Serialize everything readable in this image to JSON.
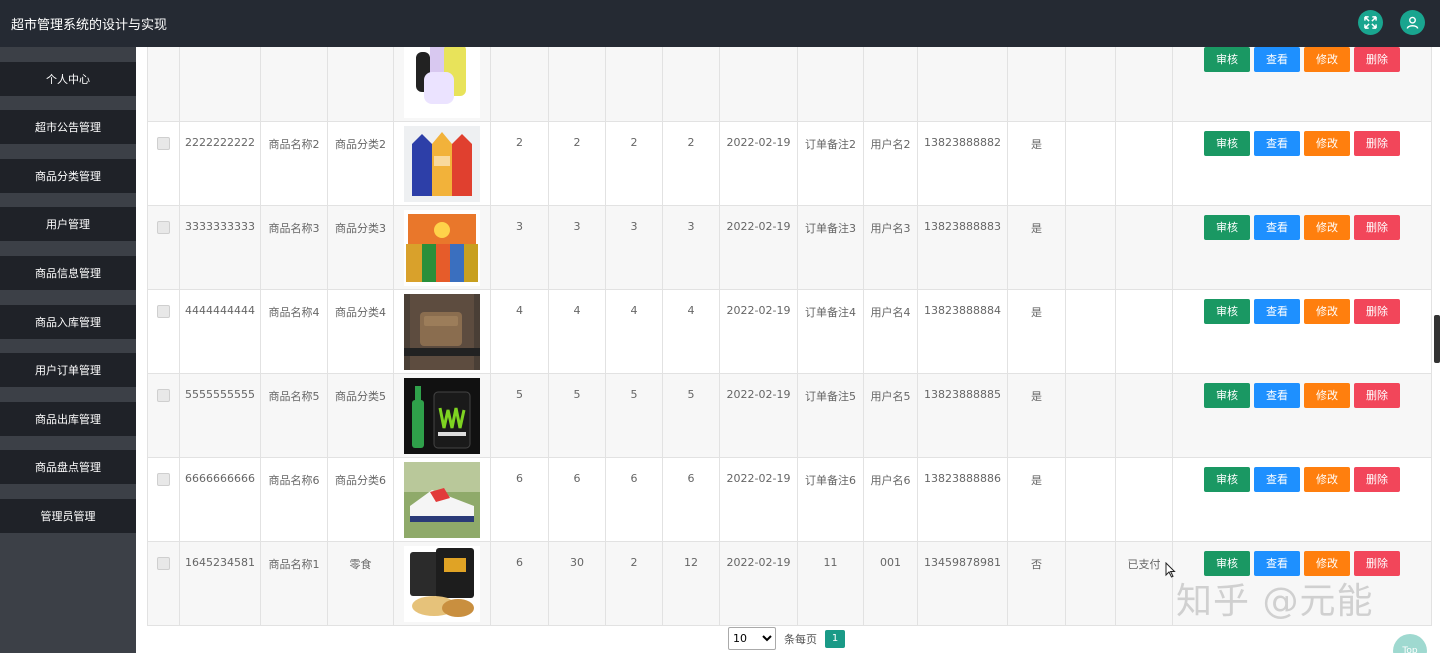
{
  "app": {
    "title": "超市管理系统的设计与实现"
  },
  "sidebar": {
    "items": [
      {
        "label": "个人中心"
      },
      {
        "label": "超市公告管理"
      },
      {
        "label": "商品分类管理"
      },
      {
        "label": "用户管理"
      },
      {
        "label": "商品信息管理"
      },
      {
        "label": "商品入库管理"
      },
      {
        "label": "用户订单管理"
      },
      {
        "label": "商品出库管理"
      },
      {
        "label": "商品盘点管理"
      },
      {
        "label": "管理员管理"
      }
    ]
  },
  "table": {
    "actions": {
      "audit": "审核",
      "view": "查看",
      "edit": "修改",
      "delete": "删除"
    },
    "rows": [
      {
        "order_no": "",
        "name": "",
        "category": "",
        "image": "phone-icon",
        "c1": "",
        "c2": "",
        "c3": "",
        "c4": "",
        "date": "",
        "note": "",
        "user": "",
        "phone": "",
        "flag": "",
        "extra": "",
        "status": ""
      },
      {
        "order_no": "2222222222",
        "name": "商品名称2",
        "category": "商品分类2",
        "image": "milk-cartons-image",
        "c1": "2",
        "c2": "2",
        "c3": "2",
        "c4": "2",
        "date": "2022-02-19",
        "note": "订单备注2",
        "user": "用户名2",
        "phone": "13823888882",
        "flag": "是",
        "extra": "",
        "status": ""
      },
      {
        "order_no": "3333333333",
        "name": "商品名称3",
        "category": "商品分类3",
        "image": "snacks-image",
        "c1": "3",
        "c2": "3",
        "c3": "3",
        "c4": "3",
        "date": "2022-02-19",
        "note": "订单备注3",
        "user": "用户名3",
        "phone": "13823888883",
        "flag": "是",
        "extra": "",
        "status": ""
      },
      {
        "order_no": "4444444444",
        "name": "商品名称4",
        "category": "商品分类4",
        "image": "waist-bag-image",
        "c1": "4",
        "c2": "4",
        "c3": "4",
        "c4": "4",
        "date": "2022-02-19",
        "note": "订单备注4",
        "user": "用户名4",
        "phone": "13823888884",
        "flag": "是",
        "extra": "",
        "status": ""
      },
      {
        "order_no": "5555555555",
        "name": "商品名称5",
        "category": "商品分类5",
        "image": "energy-drink-image",
        "c1": "5",
        "c2": "5",
        "c3": "5",
        "c4": "5",
        "date": "2022-02-19",
        "note": "订单备注5",
        "user": "用户名5",
        "phone": "13823888885",
        "flag": "是",
        "extra": "",
        "status": ""
      },
      {
        "order_no": "6666666666",
        "name": "商品名称6",
        "category": "商品分类6",
        "image": "sneaker-image",
        "c1": "6",
        "c2": "6",
        "c3": "6",
        "c4": "6",
        "date": "2022-02-19",
        "note": "订单备注6",
        "user": "用户名6",
        "phone": "13823888886",
        "flag": "是",
        "extra": "",
        "status": ""
      },
      {
        "order_no": "1645234581",
        "name": "商品名称1",
        "category": "零食",
        "image": "nuts-image",
        "c1": "6",
        "c2": "30",
        "c3": "2",
        "c4": "12",
        "date": "2022-02-19",
        "note": "11",
        "user": "001",
        "phone": "13459878981",
        "flag": "否",
        "extra": "",
        "status": "已支付"
      }
    ]
  },
  "pagination": {
    "page_size": "10",
    "per_page_label": "条每页",
    "current_page": "1",
    "page_size_options": [
      "10"
    ]
  },
  "watermark": {
    "text": "知乎 @元能"
  },
  "fab": {
    "label": "Top"
  },
  "colors": {
    "topbar": "#252a33",
    "sidebar": "#3c4047",
    "sidebar_item": "#1f2228",
    "accent": "#19a58f",
    "audit": "#1a9863",
    "view": "#1e90ff",
    "edit": "#ff7f0e",
    "delete": "#f2465a"
  }
}
